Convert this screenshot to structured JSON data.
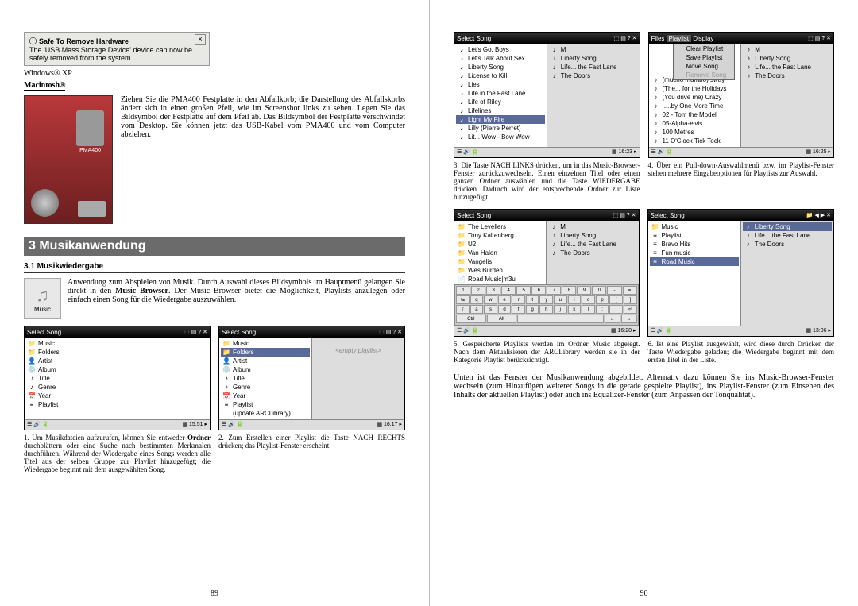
{
  "left_page": {
    "safe_remove": {
      "title": "Safe To Remove Hardware",
      "body": "The 'USB Mass Storage Device' device can now be safely removed from the system."
    },
    "winxp": "Windows® XP",
    "macintosh_label": "Macintosh®",
    "mac_text": "Ziehen Sie die PMA400 Festplatte in den Abfallkorb; die Darstellung des Abfallskorbs ändert sich in einen großen Pfeil, wie im Screenshot links zu sehen. Legen Sie das Bildsymbol der Festplatte auf dem Pfeil ab. Das Bildsymbol der Festplatte verschwindet vom Desktop. Sie können jetzt das USB-Kabel vom PMA400 und vom Computer abziehen.",
    "section_header": "3   Musikanwendung",
    "subsection": "3.1    Musikwiedergabe",
    "music_icon_label": "Music",
    "music_intro": "Anwendung zum Abspielen von Musik. Durch Auswahl dieses Bildsymbols im Hauptmenü gelangen Sie direkt in den Music Browser. Der Music Browser bietet die Möglichkeit, Playlists anzulegen oder einfach einen Song für die Wiedergabe auszuwählen.",
    "panel1_title": "Select Song",
    "panel1_items": [
      {
        "icon": "📁",
        "label": "Music"
      },
      {
        "icon": "📁",
        "label": "Folders"
      },
      {
        "icon": "👤",
        "label": "Artist"
      },
      {
        "icon": "💿",
        "label": "Album"
      },
      {
        "icon": "♪",
        "label": "Title"
      },
      {
        "icon": "♪",
        "label": "Genre"
      },
      {
        "icon": "📅",
        "label": "Year"
      },
      {
        "icon": "≡",
        "label": "Playlist"
      }
    ],
    "panel1_time": "15:51",
    "panel2_title": "Select Song",
    "panel2_left_items": [
      {
        "icon": "📁",
        "label": "Music"
      },
      {
        "icon": "📁",
        "label": "Folders",
        "sel": true
      },
      {
        "icon": "👤",
        "label": "Artist"
      },
      {
        "icon": "💿",
        "label": "Album"
      },
      {
        "icon": "♪",
        "label": "Title"
      },
      {
        "icon": "♪",
        "label": "Genre"
      },
      {
        "icon": "📅",
        "label": "Year"
      },
      {
        "icon": "≡",
        "label": "Playlist"
      },
      {
        "icon": " ",
        "label": "(update ARCLibrary)"
      }
    ],
    "panel2_empty": "<empty playlist>",
    "panel2_time": "16:17",
    "caption1": "1. Um Musikdateien aufzurufen, können Sie entweder Ordner durchblättern oder eine Suche nach bestimmten Merkmalen durchführen. Während der Wiedergabe eines Songs werden alle Titel aus der selben Gruppe zur Playlist hinzugefügt; die Wiedergabe beginnt mit dem ausgewählten Song.",
    "caption2": "2. Zum Erstellen einer Playlist die Taste NACH RECHTS drücken; das Playlist-Fenster erscheint.",
    "page_number": "89"
  },
  "right_page": {
    "panel3_title": "Select Song",
    "panel3_left_items": [
      {
        "icon": "♪",
        "label": "Let's Go, Boys"
      },
      {
        "icon": "♪",
        "label": "Let's Talk About Sex"
      },
      {
        "icon": "♪",
        "label": "Liberty Song"
      },
      {
        "icon": "♪",
        "label": "License to Kill"
      },
      {
        "icon": "♪",
        "label": "Lies"
      },
      {
        "icon": "♪",
        "label": "Life in the Fast Lane"
      },
      {
        "icon": "♪",
        "label": "Life of Riley"
      },
      {
        "icon": "♪",
        "label": "Lifelines"
      },
      {
        "icon": "♪",
        "label": "Light My Fire",
        "sel": true
      },
      {
        "icon": "♪",
        "label": "Lilly (Pierre Perret)"
      },
      {
        "icon": "♪",
        "label": "Lit... Wow - Bow Wow"
      }
    ],
    "panel3_right_items": [
      {
        "icon": "♪",
        "label": "M"
      },
      {
        "icon": "♪",
        "label": "Liberty Song"
      },
      {
        "icon": "♪",
        "label": "Life... the Fast Lane"
      },
      {
        "icon": "♪",
        "label": "The Doors"
      }
    ],
    "panel3_time": "16:23",
    "panel4_titlebar_tabs": [
      "Files",
      "Playlist",
      "Display"
    ],
    "panel4_menu": [
      {
        "label": "Clear Playlist"
      },
      {
        "label": "Save Playlist"
      },
      {
        "label": "Move Song"
      },
      {
        "label": "Remove Song",
        "disabled": true
      }
    ],
    "panel4_items": [
      {
        "icon": "♪",
        "label": "(mucho mambo) sway"
      },
      {
        "icon": "♪",
        "label": "(The... for the Holidays"
      },
      {
        "icon": "♪",
        "label": "(You drive me) Crazy"
      },
      {
        "icon": "♪",
        "label": ".....by One More Time"
      },
      {
        "icon": "♪",
        "label": "02 - Tom the Model"
      },
      {
        "icon": "♪",
        "label": "05-Alpha-elvis"
      },
      {
        "icon": "♪",
        "label": "100 Metres"
      },
      {
        "icon": "♪",
        "label": "11 O'Clock Tick Tock"
      }
    ],
    "panel4_right_items": [
      {
        "icon": "♪",
        "label": "M"
      },
      {
        "icon": "♪",
        "label": "Liberty Song"
      },
      {
        "icon": "♪",
        "label": "Life... the Fast Lane"
      },
      {
        "icon": "♪",
        "label": "The Doors"
      }
    ],
    "panel4_time": "16:25",
    "caption3": "3. Die Taste NACH LINKS drücken, um in das Music-Browser-Fenster zurückzuwechseln. Einen einzelnen Titel oder einen ganzen Ordner auswählen und die Taste WIEDERGABE drücken. Dadurch wird der entsprechende Ordner zur Liste hinzugefügt.",
    "caption4": "4. Über ein Pull-down-Auswahlmenü bzw. im Playlist-Fenster stehen mehrere Eingabeoptionen für Playlists zur Auswahl.",
    "panel5_title": "Select Song",
    "panel5_left_items": [
      {
        "icon": "📁",
        "label": "The Levellers"
      },
      {
        "icon": "📁",
        "label": "Tony Kaltenberg"
      },
      {
        "icon": "📁",
        "label": "U2"
      },
      {
        "icon": "📁",
        "label": "Van Halen"
      },
      {
        "icon": "📁",
        "label": "Vangelis"
      },
      {
        "icon": "📁",
        "label": "Wes Burden"
      },
      {
        "icon": "📄",
        "label": "Road Music|m3u"
      }
    ],
    "panel5_right_items": [
      {
        "icon": "♪",
        "label": "M"
      },
      {
        "icon": "♪",
        "label": "Liberty Song"
      },
      {
        "icon": "♪",
        "label": "Life... the Fast Lane"
      },
      {
        "icon": "♪",
        "label": "The Doors"
      }
    ],
    "panel5_time": "16:28",
    "kb_rows": [
      [
        "1",
        "2",
        "3",
        "4",
        "5",
        "6",
        "7",
        "8",
        "9",
        "0",
        "-",
        "="
      ],
      [
        "↹",
        "q",
        "w",
        "e",
        "r",
        "t",
        "y",
        "u",
        "i",
        "o",
        "p",
        "[",
        "]"
      ],
      [
        "⇧",
        "a",
        "s",
        "d",
        "f",
        "g",
        "h",
        "j",
        "k",
        "l",
        ";",
        "'",
        "⏎"
      ],
      [
        "Ctrl",
        "Alt",
        "",
        "←",
        "→"
      ]
    ],
    "panel6_title": "Select Song",
    "panel6_left_items": [
      {
        "icon": "📁",
        "label": "Music"
      },
      {
        "icon": "≡",
        "label": "Playlist"
      },
      {
        "icon": "≡",
        "label": "Bravo Hits"
      },
      {
        "icon": "≡",
        "label": "Fun music"
      },
      {
        "icon": "≡",
        "label": "Road Music",
        "sel": true
      }
    ],
    "panel6_right_items": [
      {
        "icon": "♪",
        "label": "Liberty Song",
        "sel": true
      },
      {
        "icon": "♪",
        "label": "Life... the Fast Lane"
      },
      {
        "icon": "♪",
        "label": "The Doors"
      }
    ],
    "panel6_time": "13:06",
    "caption5": "5. Gespeicherte Playlists werden im Ordner Music abgelegt. Nach dem Aktualisieren der ARCLibrary werden sie in der Kategorie Playlist berücksichtigt.",
    "caption6": "6. Ist eine Playlist ausgewählt, wird diese durch Drücken der Taste Wiedergabe geladen; die Wiedergabe beginnt mit dem ersten Titel in der Liste.",
    "bottom_text": "Unten ist das Fenster der Musikanwendung abgebildet. Alternativ dazu können Sie ins Music-Browser-Fenster wechseln (zum Hinzufügen weiterer Songs in die gerade gespielte Playlist), ins Playlist-Fenster (zum Einsehen des Inhalts der aktuellen Playlist) oder auch ins Equalizer-Fenster (zum Anpassen der Tonqualität).",
    "page_number": "90"
  }
}
